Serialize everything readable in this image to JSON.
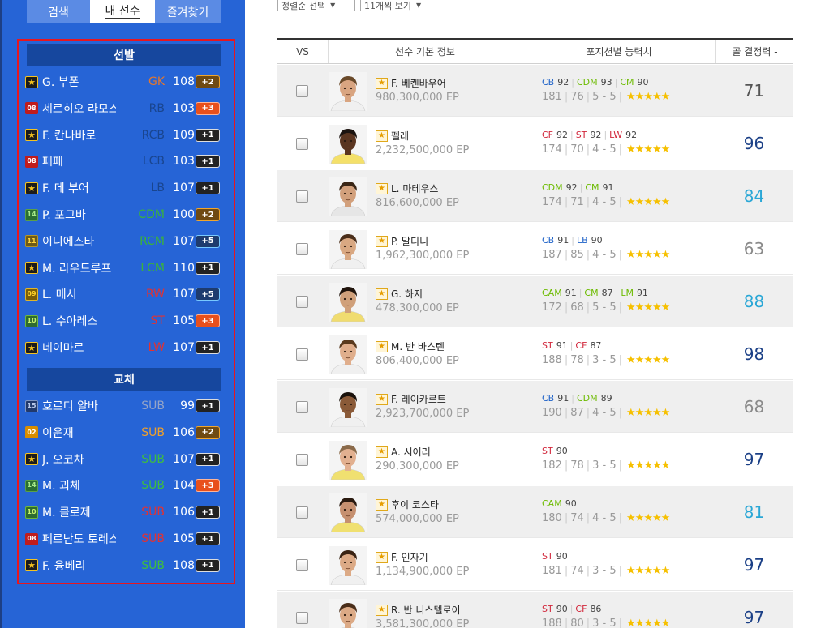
{
  "tabs": [
    "검색",
    "내 선수",
    "즐겨찾기"
  ],
  "sections": {
    "starting": "선발",
    "subs": "교체"
  },
  "squad": [
    {
      "season": "icon",
      "season_label": "★",
      "name": "G. 부폰",
      "pos": "GK",
      "pos_class": "c-gk",
      "ovr": "108",
      "boost": "+2",
      "boost_class": "b2"
    },
    {
      "season": "08",
      "season_label": "08",
      "name": "세르히오 라모스",
      "pos": "RB",
      "pos_class": "c-def",
      "ovr": "103",
      "boost": "+3",
      "boost_class": "b3"
    },
    {
      "season": "icon",
      "season_label": "★",
      "name": "F. 칸나바로",
      "pos": "RCB",
      "pos_class": "c-def",
      "ovr": "109",
      "boost": "+1",
      "boost_class": ""
    },
    {
      "season": "08",
      "season_label": "08",
      "name": "페페",
      "pos": "LCB",
      "pos_class": "c-def",
      "ovr": "103",
      "boost": "+1",
      "boost_class": ""
    },
    {
      "season": "icon",
      "season_label": "★",
      "name": "F. 데 부어",
      "pos": "LB",
      "pos_class": "c-def",
      "ovr": "107",
      "boost": "+1",
      "boost_class": ""
    },
    {
      "season": "14",
      "season_label": "14",
      "name": "P. 포그바",
      "pos": "CDM",
      "pos_class": "c-mid",
      "ovr": "100",
      "boost": "+2",
      "boost_class": "b2"
    },
    {
      "season": "11",
      "season_label": "11",
      "name": "이니에스타",
      "pos": "RCM",
      "pos_class": "c-mid",
      "ovr": "107",
      "boost": "+5",
      "boost_class": "b5"
    },
    {
      "season": "icon",
      "season_label": "★",
      "name": "M. 라우드루프",
      "pos": "LCM",
      "pos_class": "c-mid",
      "ovr": "110",
      "boost": "+1",
      "boost_class": ""
    },
    {
      "season": "09",
      "season_label": "09",
      "name": "L. 메시",
      "pos": "RW",
      "pos_class": "c-fw",
      "ovr": "107",
      "boost": "+5",
      "boost_class": "b5"
    },
    {
      "season": "10",
      "season_label": "10",
      "name": "L. 수아레스",
      "pos": "ST",
      "pos_class": "c-fw",
      "ovr": "105",
      "boost": "+3",
      "boost_class": "b3"
    },
    {
      "season": "icon",
      "season_label": "★",
      "name": "네이마르",
      "pos": "LW",
      "pos_class": "c-fw",
      "ovr": "107",
      "boost": "+1",
      "boost_class": ""
    }
  ],
  "subs": [
    {
      "season": "15",
      "season_label": "15",
      "name": "호르디 알바",
      "pos": "SUB",
      "pos_class": "c-subg",
      "ovr": "99",
      "boost": "+1",
      "boost_class": ""
    },
    {
      "season": "02",
      "season_label": "02",
      "name": "이운재",
      "pos": "SUB",
      "pos_class": "c-subo",
      "ovr": "106",
      "boost": "+2",
      "boost_class": "b2"
    },
    {
      "season": "icon",
      "season_label": "★",
      "name": "J. 오코차",
      "pos": "SUB",
      "pos_class": "c-sub",
      "ovr": "107",
      "boost": "+1",
      "boost_class": ""
    },
    {
      "season": "14",
      "season_label": "14",
      "name": "M. 괴체",
      "pos": "SUB",
      "pos_class": "c-sub",
      "ovr": "104",
      "boost": "+3",
      "boost_class": "b3"
    },
    {
      "season": "10",
      "season_label": "10",
      "name": "M. 클로제",
      "pos": "SUB",
      "pos_class": "c-subr",
      "ovr": "106",
      "boost": "+1",
      "boost_class": ""
    },
    {
      "season": "08",
      "season_label": "08",
      "name": "페르난도 토레스",
      "pos": "SUB",
      "pos_class": "c-subr",
      "ovr": "105",
      "boost": "+1",
      "boost_class": ""
    },
    {
      "season": "icon",
      "season_label": "★",
      "name": "F. 융베리",
      "pos": "SUB",
      "pos_class": "c-sub",
      "ovr": "108",
      "boost": "+1",
      "boost_class": ""
    }
  ],
  "filters": {
    "sort": "정렬순 선택",
    "count": "11개씩 보기",
    "arrow": "▼"
  },
  "table_headers": [
    "VS",
    "선수 기본 정보",
    "포지션별 능력치",
    "골 결정력 -"
  ],
  "star_icon": "★",
  "stars": "★★★★★",
  "players": [
    {
      "name": "F. 베켄바우어",
      "ep": "980,300,000 EP",
      "positions": [
        {
          "p": "CB",
          "v": "92"
        },
        {
          "p": "CDM",
          "v": "93"
        },
        {
          "p": "CM",
          "v": "90"
        }
      ],
      "height": "181",
      "weight": "76",
      "skill": "5 - 5",
      "gp": "71",
      "gp_color": "#555555",
      "skin": "#d9a581",
      "hair": "#6a4a2a",
      "shirt": "#f0f0f0"
    },
    {
      "name": "펠레",
      "ep": "2,232,500,000 EP",
      "positions": [
        {
          "p": "CF",
          "v": "92"
        },
        {
          "p": "ST",
          "v": "92"
        },
        {
          "p": "LW",
          "v": "92"
        }
      ],
      "height": "174",
      "weight": "70",
      "skill": "4 - 5",
      "gp": "96",
      "gp_color": "#1a3f86",
      "skin": "#5a3520",
      "hair": "#1c1410",
      "shirt": "#f4e06a"
    },
    {
      "name": "L. 마테우스",
      "ep": "816,600,000 EP",
      "positions": [
        {
          "p": "CDM",
          "v": "92"
        },
        {
          "p": "CM",
          "v": "91"
        }
      ],
      "height": "174",
      "weight": "71",
      "skill": "4 - 5",
      "gp": "84",
      "gp_color": "#2aa7d6",
      "skin": "#d2a07c",
      "hair": "#3a2616",
      "shirt": "#e6e6e6"
    },
    {
      "name": "P. 말디니",
      "ep": "1,962,300,000 EP",
      "positions": [
        {
          "p": "CB",
          "v": "91"
        },
        {
          "p": "LB",
          "v": "90"
        }
      ],
      "height": "187",
      "weight": "85",
      "skill": "4 - 5",
      "gp": "63",
      "gp_color": "#8a8a8a",
      "skin": "#d9a882",
      "hair": "#4a2e1a",
      "shirt": "#f0f0f0"
    },
    {
      "name": "G. 하지",
      "ep": "478,300,000 EP",
      "positions": [
        {
          "p": "CAM",
          "v": "91"
        },
        {
          "p": "CM",
          "v": "87"
        },
        {
          "p": "LM",
          "v": "91"
        }
      ],
      "height": "172",
      "weight": "68",
      "skill": "5 - 5",
      "gp": "88",
      "gp_color": "#2aa7d6",
      "skin": "#d0a07a",
      "hair": "#20140c",
      "shirt": "#f0dc70"
    },
    {
      "name": "M. 반 바스텐",
      "ep": "806,400,000 EP",
      "positions": [
        {
          "p": "ST",
          "v": "91"
        },
        {
          "p": "CF",
          "v": "87"
        }
      ],
      "height": "188",
      "weight": "78",
      "skill": "3 - 5",
      "gp": "98",
      "gp_color": "#1a3f86",
      "skin": "#e0ae8c",
      "hair": "#5a3a1e",
      "shirt": "#f0f0f0"
    },
    {
      "name": "F. 레이카르트",
      "ep": "2,923,700,000 EP",
      "positions": [
        {
          "p": "CB",
          "v": "91"
        },
        {
          "p": "CDM",
          "v": "89"
        }
      ],
      "height": "190",
      "weight": "87",
      "skill": "4 - 5",
      "gp": "68",
      "gp_color": "#8a8a8a",
      "skin": "#8a5a38",
      "hair": "#1a120c",
      "shirt": "#f0f0f0"
    },
    {
      "name": "A. 시어러",
      "ep": "290,300,000 EP",
      "positions": [
        {
          "p": "ST",
          "v": "90"
        }
      ],
      "height": "182",
      "weight": "78",
      "skill": "3 - 5",
      "gp": "97",
      "gp_color": "#1a3f86",
      "skin": "#e2b090",
      "hair": "#8a6a4a",
      "shirt": "#f0e070"
    },
    {
      "name": "후이 코스타",
      "ep": "574,000,000 EP",
      "positions": [
        {
          "p": "CAM",
          "v": "90"
        }
      ],
      "height": "180",
      "weight": "74",
      "skill": "4 - 5",
      "gp": "81",
      "gp_color": "#2aa7d6",
      "skin": "#c69070",
      "hair": "#2a1a10",
      "shirt": "#f0e070"
    },
    {
      "name": "F. 인자기",
      "ep": "1,134,900,000 EP",
      "positions": [
        {
          "p": "ST",
          "v": "90"
        }
      ],
      "height": "181",
      "weight": "74",
      "skill": "3 - 5",
      "gp": "97",
      "gp_color": "#1a3f86",
      "skin": "#dcaa86",
      "hair": "#3a2414",
      "shirt": "#f0f0f0"
    },
    {
      "name": "R. 반 니스텔로이",
      "ep": "3,581,300,000 EP",
      "positions": [
        {
          "p": "ST",
          "v": "90"
        },
        {
          "p": "CF",
          "v": "86"
        }
      ],
      "height": "188",
      "weight": "80",
      "skill": "3 - 5",
      "gp": "97",
      "gp_color": "#1a3f86",
      "skin": "#dcaa86",
      "hair": "#4a2e1a",
      "shirt": "#f0f0f0"
    }
  ]
}
